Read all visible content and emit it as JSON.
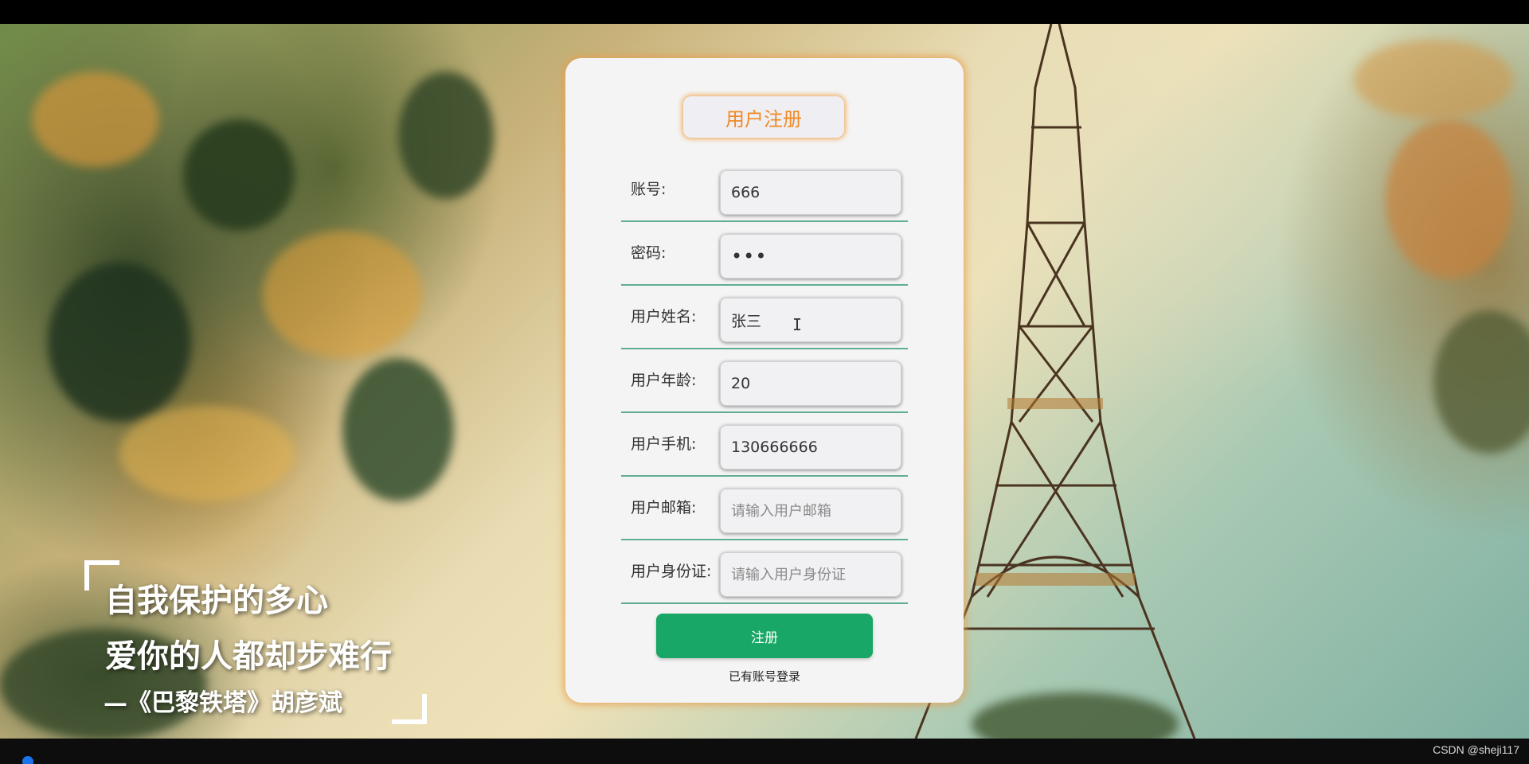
{
  "background": {
    "quote": {
      "line1": "自我保护的多心",
      "line2": "爱你的人都却步难行",
      "line3": "—《巴黎铁塔》胡彦斌"
    }
  },
  "form": {
    "title": "用户注册",
    "fields": [
      {
        "label": "账号:",
        "value": "666",
        "placeholder": ""
      },
      {
        "label": "密码:",
        "value": "•••",
        "placeholder": ""
      },
      {
        "label": "用户姓名:",
        "value": "张三",
        "placeholder": ""
      },
      {
        "label": "用户年龄:",
        "value": "20",
        "placeholder": ""
      },
      {
        "label": "用户手机:",
        "value": "130666666",
        "placeholder": ""
      },
      {
        "label": "用户邮箱:",
        "value": "",
        "placeholder": "请输入用户邮箱"
      },
      {
        "label": "用户身份证:",
        "value": "",
        "placeholder": "请输入用户身份证"
      }
    ],
    "submit_label": "注册",
    "login_link": "已有账号登录"
  },
  "footer": {
    "watermark": "CSDN @sheji117"
  },
  "colors": {
    "accent_orange": "#ef8a26",
    "button_green": "#18a766",
    "divider_teal": "#5fae94"
  }
}
